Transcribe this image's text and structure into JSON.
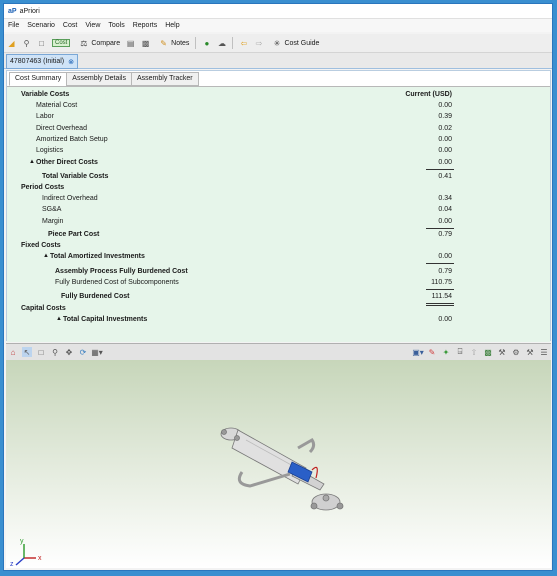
{
  "window": {
    "logo": "aP",
    "title": "aPriori"
  },
  "menu": [
    "File",
    "Scenario",
    "Cost",
    "View",
    "Tools",
    "Reports",
    "Help"
  ],
  "toolbar": {
    "cost_label": "Cost",
    "compare_label": "Compare",
    "notes_label": "Notes",
    "cost_guide_label": "Cost Guide"
  },
  "doc_tab": {
    "label": "47807463 (Initial)"
  },
  "subtabs": [
    "Cost Summary",
    "Assembly Details",
    "Assembly Tracker"
  ],
  "cost_table": {
    "header": "Current (USD)",
    "rows": [
      {
        "label": "Variable Costs",
        "value": ""
      },
      {
        "label": "Material Cost",
        "value": "0.00"
      },
      {
        "label": "Labor",
        "value": "0.39"
      },
      {
        "label": "Direct Overhead",
        "value": "0.02"
      },
      {
        "label": "Amortized Batch Setup",
        "value": "0.00"
      },
      {
        "label": "Logistics",
        "value": "0.00"
      },
      {
        "label": "Other Direct Costs",
        "value": "0.00"
      },
      {
        "label": "Total Variable Costs",
        "value": "0.41"
      },
      {
        "label": "Period Costs",
        "value": ""
      },
      {
        "label": "Indirect Overhead",
        "value": "0.34"
      },
      {
        "label": "SG&A",
        "value": "0.04"
      },
      {
        "label": "Margin",
        "value": "0.00"
      },
      {
        "label": "Piece Part Cost",
        "value": "0.79"
      },
      {
        "label": "Fixed Costs",
        "value": ""
      },
      {
        "label": "Total Amortized Investments",
        "value": "0.00"
      },
      {
        "label": "Assembly Process Fully Burdened Cost",
        "value": "0.79"
      },
      {
        "label": "Fully Burdened Cost of Subcomponents",
        "value": "110.75"
      },
      {
        "label": "Fully Burdened Cost",
        "value": "111.54"
      },
      {
        "label": "Capital Costs",
        "value": ""
      },
      {
        "label": "Total Capital Investments",
        "value": "0.00"
      }
    ]
  },
  "viewer": {
    "axis_x": "x",
    "axis_y": "y",
    "axis_z": "z"
  }
}
